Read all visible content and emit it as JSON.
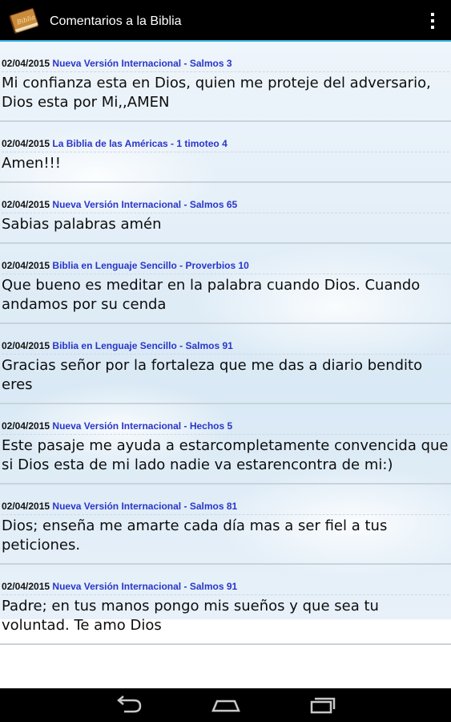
{
  "header": {
    "title": "Comentarios a la Biblia",
    "icon": "bible-book-icon",
    "icon_text": "Biblia"
  },
  "comments": [
    {
      "date": "02/04/2015",
      "version": "Nueva Versión Internacional",
      "separator": "-",
      "reference": "Salmos 3",
      "text": "Mi confianza esta en Dios, quien me proteje del adversario, Dios esta por Mi,,AMEN"
    },
    {
      "date": "02/04/2015",
      "version": "La Biblia de las Américas",
      "separator": "-",
      "reference": "1 timoteo 4",
      "text": "Amen!!!"
    },
    {
      "date": "02/04/2015",
      "version": "Nueva Versión Internacional",
      "separator": "-",
      "reference": "Salmos 65",
      "text": "Sabias palabras amén"
    },
    {
      "date": "02/04/2015",
      "version": "Biblia en Lenguaje Sencillo",
      "separator": "-",
      "reference": "Proverbios 10",
      "text": "Que bueno es meditar en la palabra cuando Dios. Cuando andamos por su cenda"
    },
    {
      "date": "02/04/2015",
      "version": "Biblia en Lenguaje Sencillo",
      "separator": "-",
      "reference": "Salmos 91",
      "text": "Gracias señor por la fortaleza que me das a diario bendito eres"
    },
    {
      "date": "02/04/2015",
      "version": "Nueva Versión Internacional",
      "separator": "-",
      "reference": "Hechos 5",
      "text": "Este pasaje me ayuda a estarcompletamente convencida que si Dios esta de mi lado nadie va estarencontra de mi:)"
    },
    {
      "date": "02/04/2015",
      "version": "Nueva Versión Internacional",
      "separator": "-",
      "reference": "Salmos 81",
      "text": "Dios; enseña me amarte cada día mas a ser fiel a tus peticiones."
    },
    {
      "date": "02/04/2015",
      "version": "Nueva Versión Internacional",
      "separator": "-",
      "reference": "Salmos 91",
      "text": "Padre; en tus manos pongo mis sueños y que sea tu voluntad. Te amo Dios"
    }
  ],
  "navbar": {
    "buttons": [
      "back-icon",
      "home-icon",
      "recent-apps-icon"
    ]
  },
  "colors": {
    "actionbar": "#000000",
    "accent": "#33b5e5",
    "link": "#2a36c8"
  }
}
